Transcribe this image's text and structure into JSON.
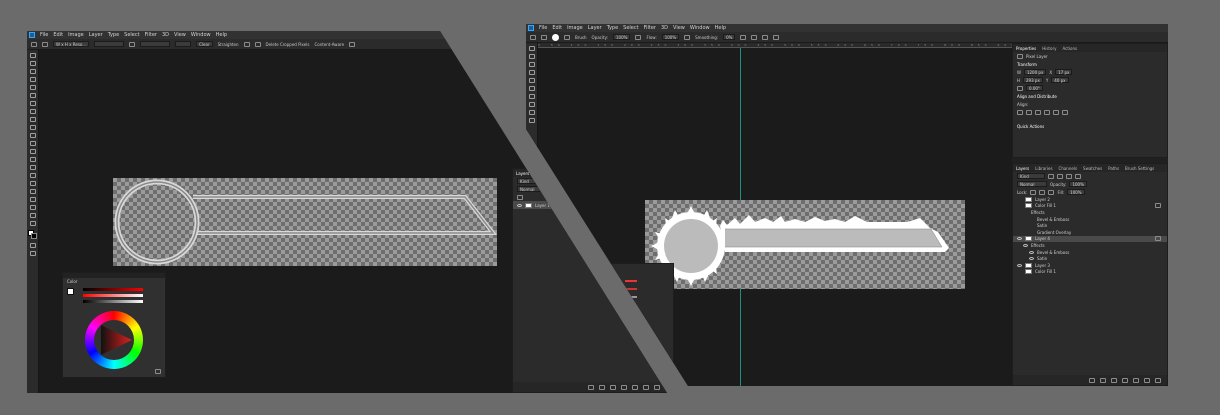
{
  "menu": [
    "File",
    "Edit",
    "Image",
    "Layer",
    "Type",
    "Select",
    "Filter",
    "3D",
    "View",
    "Window",
    "Help"
  ],
  "left": {
    "options": {
      "size": "W x H x Reso...",
      "clear": "Clear",
      "straighten": "Straighten",
      "delete_cropped": "Delete Cropped Pixels",
      "content_aware": "Content-Aware"
    },
    "color_panel": {
      "title": "Color"
    },
    "layers_panel": {
      "tab": "Layers",
      "kind": "Kind",
      "blend": "Normal",
      "layer": "Layer 1"
    }
  },
  "right": {
    "options": {
      "mode": "Brush",
      "opacity": "Opacity:",
      "opacity_val": "100%",
      "flow": "Flow:",
      "flow_val": "100%",
      "smoothing": "Smoothing:",
      "smoothing_val": "0%"
    },
    "ruler": "0 50 100 150 200 250 300 350 400 450 500 550 600 650 700 750 800 850 900",
    "properties": {
      "tabs": [
        "Properties",
        "History",
        "Actions"
      ],
      "doc_label": "Pixel Layer",
      "transform": "Transform",
      "w": "1200 px",
      "x": "17 px",
      "h": "293 px",
      "y": "40 px",
      "angle": "0.00°",
      "align": "Align and Distribute",
      "align_sub": "Align:",
      "quick": "Quick Actions"
    },
    "layers": {
      "tabs": [
        "Layers",
        "Libraries",
        "Channels",
        "Swatches",
        "Paths",
        "Brush Settings"
      ],
      "kind": "Kind",
      "blend": "Normal",
      "opacity": "Opacity:",
      "opacity_val": "100%",
      "lock": "Lock:",
      "fill": "Fill:",
      "fill_val": "100%",
      "rows": [
        {
          "name": "Layer 2",
          "indent": 0,
          "eye": false,
          "fx": false
        },
        {
          "name": "Color Fill 1",
          "indent": 0,
          "eye": false,
          "fx": true
        },
        {
          "name": "Effects",
          "indent": 1,
          "eye": false,
          "fx": false
        },
        {
          "name": "Bevel & Emboss",
          "indent": 2,
          "eye": false,
          "fx": false
        },
        {
          "name": "Satin",
          "indent": 2,
          "eye": false,
          "fx": false
        },
        {
          "name": "Gradient Overlay",
          "indent": 2,
          "eye": false,
          "fx": false
        },
        {
          "name": "Layer 4",
          "indent": 0,
          "eye": true,
          "fx": true
        },
        {
          "name": "Effects",
          "indent": 1,
          "eye": true,
          "fx": false
        },
        {
          "name": "Bevel & Emboss",
          "indent": 2,
          "eye": true,
          "fx": false
        },
        {
          "name": "Satin",
          "indent": 2,
          "eye": true,
          "fx": false
        },
        {
          "name": "Layer 3",
          "indent": 0,
          "eye": true,
          "fx": false
        },
        {
          "name": "Color Fill 1",
          "indent": 0,
          "eye": false,
          "fx": false
        }
      ]
    }
  },
  "colors": {
    "accent": "#31a8ff",
    "bg": "#6b6b6b"
  }
}
